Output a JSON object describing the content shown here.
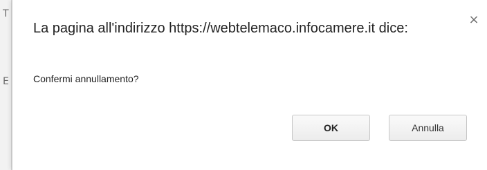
{
  "dialog": {
    "title": "La pagina all'indirizzo https://webtelemaco.infocamere.it dice:",
    "close_icon": "×",
    "message": "Confermi annullamento?",
    "buttons": {
      "ok_label": "OK",
      "cancel_label": "Annulla"
    }
  },
  "background": {
    "glyph_1": "T",
    "glyph_2": "E"
  }
}
